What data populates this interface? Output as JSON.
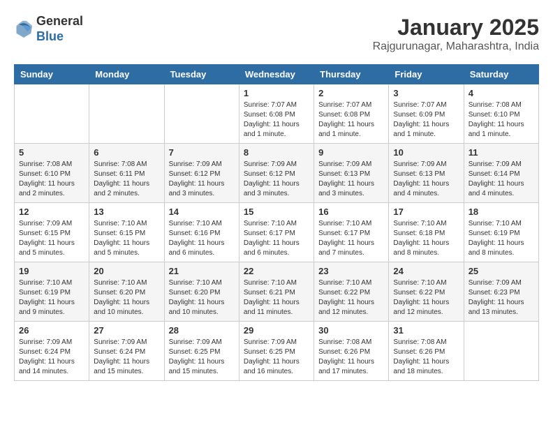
{
  "header": {
    "logo_general": "General",
    "logo_blue": "Blue",
    "month_title": "January 2025",
    "subtitle": "Rajgurunagar, Maharashtra, India"
  },
  "weekdays": [
    "Sunday",
    "Monday",
    "Tuesday",
    "Wednesday",
    "Thursday",
    "Friday",
    "Saturday"
  ],
  "weeks": [
    [
      {
        "day": "",
        "info": ""
      },
      {
        "day": "",
        "info": ""
      },
      {
        "day": "",
        "info": ""
      },
      {
        "day": "1",
        "info": "Sunrise: 7:07 AM\nSunset: 6:08 PM\nDaylight: 11 hours\nand 1 minute."
      },
      {
        "day": "2",
        "info": "Sunrise: 7:07 AM\nSunset: 6:08 PM\nDaylight: 11 hours\nand 1 minute."
      },
      {
        "day": "3",
        "info": "Sunrise: 7:07 AM\nSunset: 6:09 PM\nDaylight: 11 hours\nand 1 minute."
      },
      {
        "day": "4",
        "info": "Sunrise: 7:08 AM\nSunset: 6:10 PM\nDaylight: 11 hours\nand 1 minute."
      }
    ],
    [
      {
        "day": "5",
        "info": "Sunrise: 7:08 AM\nSunset: 6:10 PM\nDaylight: 11 hours\nand 2 minutes."
      },
      {
        "day": "6",
        "info": "Sunrise: 7:08 AM\nSunset: 6:11 PM\nDaylight: 11 hours\nand 2 minutes."
      },
      {
        "day": "7",
        "info": "Sunrise: 7:09 AM\nSunset: 6:12 PM\nDaylight: 11 hours\nand 3 minutes."
      },
      {
        "day": "8",
        "info": "Sunrise: 7:09 AM\nSunset: 6:12 PM\nDaylight: 11 hours\nand 3 minutes."
      },
      {
        "day": "9",
        "info": "Sunrise: 7:09 AM\nSunset: 6:13 PM\nDaylight: 11 hours\nand 3 minutes."
      },
      {
        "day": "10",
        "info": "Sunrise: 7:09 AM\nSunset: 6:13 PM\nDaylight: 11 hours\nand 4 minutes."
      },
      {
        "day": "11",
        "info": "Sunrise: 7:09 AM\nSunset: 6:14 PM\nDaylight: 11 hours\nand 4 minutes."
      }
    ],
    [
      {
        "day": "12",
        "info": "Sunrise: 7:09 AM\nSunset: 6:15 PM\nDaylight: 11 hours\nand 5 minutes."
      },
      {
        "day": "13",
        "info": "Sunrise: 7:10 AM\nSunset: 6:15 PM\nDaylight: 11 hours\nand 5 minutes."
      },
      {
        "day": "14",
        "info": "Sunrise: 7:10 AM\nSunset: 6:16 PM\nDaylight: 11 hours\nand 6 minutes."
      },
      {
        "day": "15",
        "info": "Sunrise: 7:10 AM\nSunset: 6:17 PM\nDaylight: 11 hours\nand 6 minutes."
      },
      {
        "day": "16",
        "info": "Sunrise: 7:10 AM\nSunset: 6:17 PM\nDaylight: 11 hours\nand 7 minutes."
      },
      {
        "day": "17",
        "info": "Sunrise: 7:10 AM\nSunset: 6:18 PM\nDaylight: 11 hours\nand 8 minutes."
      },
      {
        "day": "18",
        "info": "Sunrise: 7:10 AM\nSunset: 6:19 PM\nDaylight: 11 hours\nand 8 minutes."
      }
    ],
    [
      {
        "day": "19",
        "info": "Sunrise: 7:10 AM\nSunset: 6:19 PM\nDaylight: 11 hours\nand 9 minutes."
      },
      {
        "day": "20",
        "info": "Sunrise: 7:10 AM\nSunset: 6:20 PM\nDaylight: 11 hours\nand 10 minutes."
      },
      {
        "day": "21",
        "info": "Sunrise: 7:10 AM\nSunset: 6:20 PM\nDaylight: 11 hours\nand 10 minutes."
      },
      {
        "day": "22",
        "info": "Sunrise: 7:10 AM\nSunset: 6:21 PM\nDaylight: 11 hours\nand 11 minutes."
      },
      {
        "day": "23",
        "info": "Sunrise: 7:10 AM\nSunset: 6:22 PM\nDaylight: 11 hours\nand 12 minutes."
      },
      {
        "day": "24",
        "info": "Sunrise: 7:10 AM\nSunset: 6:22 PM\nDaylight: 11 hours\nand 12 minutes."
      },
      {
        "day": "25",
        "info": "Sunrise: 7:09 AM\nSunset: 6:23 PM\nDaylight: 11 hours\nand 13 minutes."
      }
    ],
    [
      {
        "day": "26",
        "info": "Sunrise: 7:09 AM\nSunset: 6:24 PM\nDaylight: 11 hours\nand 14 minutes."
      },
      {
        "day": "27",
        "info": "Sunrise: 7:09 AM\nSunset: 6:24 PM\nDaylight: 11 hours\nand 15 minutes."
      },
      {
        "day": "28",
        "info": "Sunrise: 7:09 AM\nSunset: 6:25 PM\nDaylight: 11 hours\nand 15 minutes."
      },
      {
        "day": "29",
        "info": "Sunrise: 7:09 AM\nSunset: 6:25 PM\nDaylight: 11 hours\nand 16 minutes."
      },
      {
        "day": "30",
        "info": "Sunrise: 7:08 AM\nSunset: 6:26 PM\nDaylight: 11 hours\nand 17 minutes."
      },
      {
        "day": "31",
        "info": "Sunrise: 7:08 AM\nSunset: 6:26 PM\nDaylight: 11 hours\nand 18 minutes."
      },
      {
        "day": "",
        "info": ""
      }
    ]
  ]
}
